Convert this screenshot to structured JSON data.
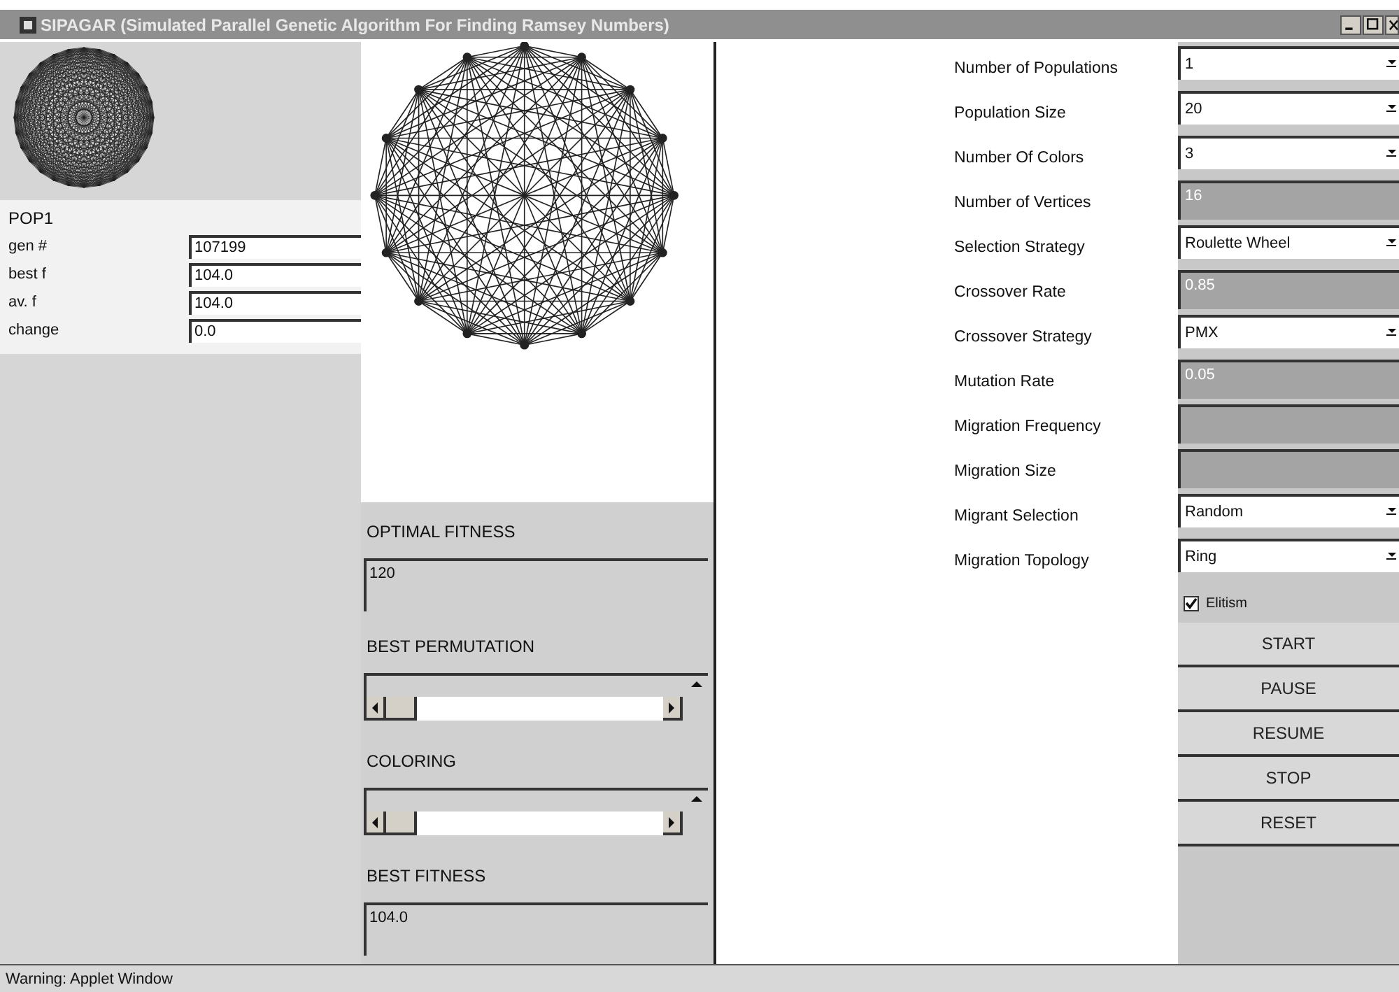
{
  "window": {
    "title": "SIPAGAR (Simulated Parallel Genetic Algorithm For Finding Ramsey Numbers)"
  },
  "population": {
    "name": "POP1",
    "stats": [
      {
        "label": "gen #",
        "value": "107199"
      },
      {
        "label": "best f",
        "value": "104.0"
      },
      {
        "label": "av. f",
        "value": "104.0"
      },
      {
        "label": "change",
        "value": "0.0"
      }
    ]
  },
  "results": [
    {
      "label": "OPTIMAL FITNESS",
      "kind": "text",
      "value": "120"
    },
    {
      "label": "BEST PERMUTATION",
      "kind": "scroll"
    },
    {
      "label": "COLORING",
      "kind": "scroll"
    },
    {
      "label": "BEST FITNESS",
      "kind": "text",
      "value": "104.0"
    }
  ],
  "parameters": [
    {
      "label": "Number of Populations",
      "kind": "dropdown",
      "value": "1"
    },
    {
      "label": "Population Size",
      "kind": "dropdown",
      "value": "20"
    },
    {
      "label": "Number Of Colors",
      "kind": "dropdown",
      "value": "3"
    },
    {
      "label": "Number of Vertices",
      "kind": "field",
      "value": "16"
    },
    {
      "label": "Selection Strategy",
      "kind": "dropdown",
      "value": "Roulette Wheel"
    },
    {
      "label": "Crossover Rate",
      "kind": "field",
      "value": "0.85"
    },
    {
      "label": "Crossover Strategy",
      "kind": "dropdown",
      "value": "PMX"
    },
    {
      "label": "Mutation Rate",
      "kind": "field",
      "value": "0.05"
    },
    {
      "label": "Migration Frequency",
      "kind": "field"
    },
    {
      "label": "Migration Size",
      "kind": "field"
    },
    {
      "label": "Migrant Selection",
      "kind": "dropdown",
      "value": "Random"
    },
    {
      "label": "Migration Topology",
      "kind": "dropdown",
      "value": "Ring"
    }
  ],
  "elitism": {
    "label": "Elitism",
    "checked": true
  },
  "buttons": [
    "START",
    "PAUSE",
    "RESUME",
    "STOP",
    "RESET"
  ],
  "status_bar": "Warning: Applet Window"
}
